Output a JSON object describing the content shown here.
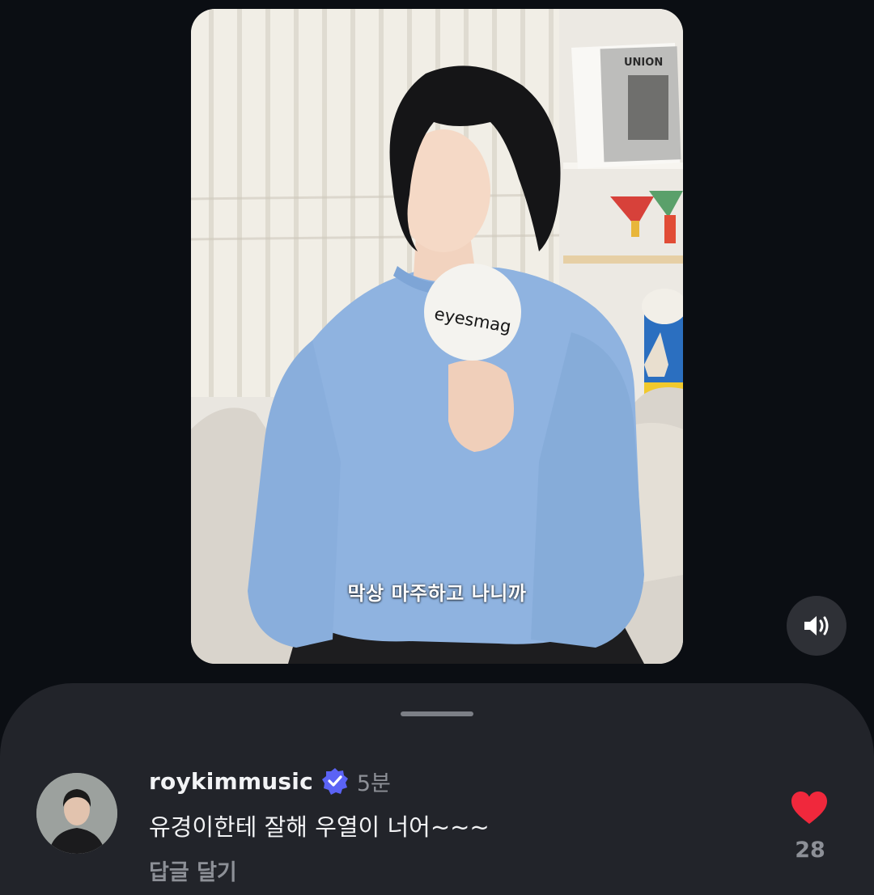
{
  "video": {
    "caption": "막상 마주하고 나니까",
    "badge_text": "eyesmag",
    "book_title": "UNION"
  },
  "sound_button": {
    "icon": "speaker-volume-icon"
  },
  "comment": {
    "username": "roykimmusic",
    "verified": true,
    "time": "5분",
    "text": "유경이한테 잘해 우열이 너어~~~",
    "reply_label": "답글 달기",
    "like_count": "28",
    "liked": true
  },
  "colors": {
    "background": "#0b0e13",
    "sheet": "#22242a",
    "like": "#f0283c",
    "verified": "#5b63f5",
    "muted_text": "#8d9097"
  }
}
